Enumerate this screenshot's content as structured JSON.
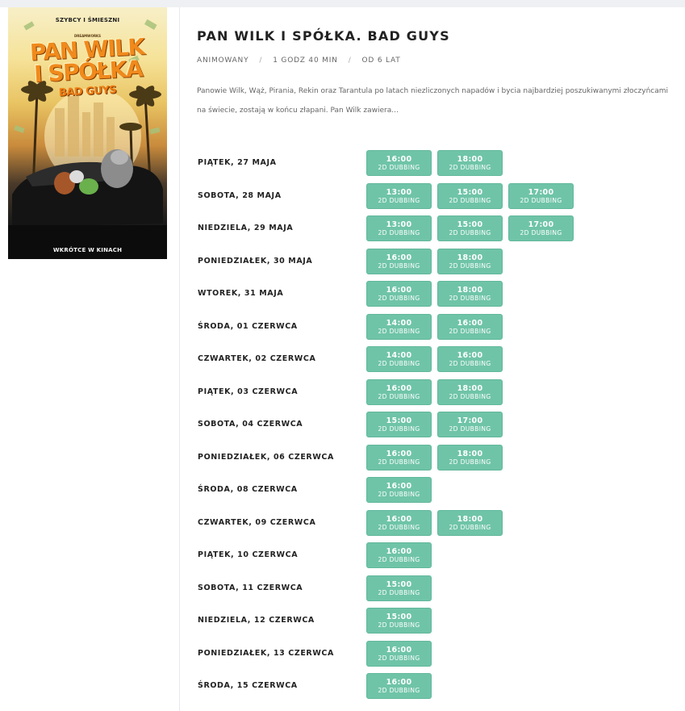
{
  "poster": {
    "tagline": "SZYBCY I ŚMIESZNI",
    "studio": "DREAMWORKS",
    "logo_line1": "PAN WILK",
    "logo_line2": "I SPÓŁKA",
    "logo_line3": "BAD GUYS",
    "cta": "WKRÓTCE W KINACH"
  },
  "movie": {
    "title": "PAN WILK I SPÓŁKA. BAD GUYS",
    "genre": "ANIMOWANY",
    "duration": "1 GODZ 40 MIN",
    "age": "OD 6 LAT",
    "separator": "/",
    "description": "Panowie Wilk, Wąż, Pirania, Rekin oraz Tarantula po latach niezliczonych napadów i bycia najbardziej poszukiwanymi złoczyńcami na świecie, zostają w końcu złapani. Pan Wilk zawiera..."
  },
  "schedule": [
    {
      "day": "PIĄTEK, 27 MAJA",
      "shows": [
        {
          "time": "16:00",
          "format": "2D DUBBING"
        },
        {
          "time": "18:00",
          "format": "2D DUBBING"
        }
      ]
    },
    {
      "day": "SOBOTA, 28 MAJA",
      "shows": [
        {
          "time": "13:00",
          "format": "2D DUBBING"
        },
        {
          "time": "15:00",
          "format": "2D DUBBING"
        },
        {
          "time": "17:00",
          "format": "2D DUBBING"
        }
      ]
    },
    {
      "day": "NIEDZIELA, 29 MAJA",
      "shows": [
        {
          "time": "13:00",
          "format": "2D DUBBING"
        },
        {
          "time": "15:00",
          "format": "2D DUBBING"
        },
        {
          "time": "17:00",
          "format": "2D DUBBING"
        }
      ]
    },
    {
      "day": "PONIEDZIAŁEK, 30 MAJA",
      "shows": [
        {
          "time": "16:00",
          "format": "2D DUBBING"
        },
        {
          "time": "18:00",
          "format": "2D DUBBING"
        }
      ]
    },
    {
      "day": "WTOREK, 31 MAJA",
      "shows": [
        {
          "time": "16:00",
          "format": "2D DUBBING"
        },
        {
          "time": "18:00",
          "format": "2D DUBBING"
        }
      ]
    },
    {
      "day": "ŚRODA, 01 CZERWCA",
      "shows": [
        {
          "time": "14:00",
          "format": "2D DUBBING"
        },
        {
          "time": "16:00",
          "format": "2D DUBBING"
        }
      ]
    },
    {
      "day": "CZWARTEK, 02 CZERWCA",
      "shows": [
        {
          "time": "14:00",
          "format": "2D DUBBING"
        },
        {
          "time": "16:00",
          "format": "2D DUBBING"
        }
      ]
    },
    {
      "day": "PIĄTEK, 03 CZERWCA",
      "shows": [
        {
          "time": "16:00",
          "format": "2D DUBBING"
        },
        {
          "time": "18:00",
          "format": "2D DUBBING"
        }
      ]
    },
    {
      "day": "SOBOTA, 04 CZERWCA",
      "shows": [
        {
          "time": "15:00",
          "format": "2D DUBBING"
        },
        {
          "time": "17:00",
          "format": "2D DUBBING"
        }
      ]
    },
    {
      "day": "PONIEDZIAŁEK, 06 CZERWCA",
      "shows": [
        {
          "time": "16:00",
          "format": "2D DUBBING"
        },
        {
          "time": "18:00",
          "format": "2D DUBBING"
        }
      ]
    },
    {
      "day": "ŚRODA, 08 CZERWCA",
      "shows": [
        {
          "time": "16:00",
          "format": "2D DUBBING"
        }
      ]
    },
    {
      "day": "CZWARTEK, 09 CZERWCA",
      "shows": [
        {
          "time": "16:00",
          "format": "2D DUBBING"
        },
        {
          "time": "18:00",
          "format": "2D DUBBING"
        }
      ]
    },
    {
      "day": "PIĄTEK, 10 CZERWCA",
      "shows": [
        {
          "time": "16:00",
          "format": "2D DUBBING"
        }
      ]
    },
    {
      "day": "SOBOTA, 11 CZERWCA",
      "shows": [
        {
          "time": "15:00",
          "format": "2D DUBBING"
        }
      ]
    },
    {
      "day": "NIEDZIELA, 12 CZERWCA",
      "shows": [
        {
          "time": "15:00",
          "format": "2D DUBBING"
        }
      ]
    },
    {
      "day": "PONIEDZIAŁEK, 13 CZERWCA",
      "shows": [
        {
          "time": "16:00",
          "format": "2D DUBBING"
        }
      ]
    },
    {
      "day": "ŚRODA, 15 CZERWCA",
      "shows": [
        {
          "time": "16:00",
          "format": "2D DUBBING"
        }
      ]
    }
  ],
  "colors": {
    "slot_bg": "#6fc4a8",
    "slot_text": "#ffffff",
    "logo_orange": "#f08a1c"
  }
}
